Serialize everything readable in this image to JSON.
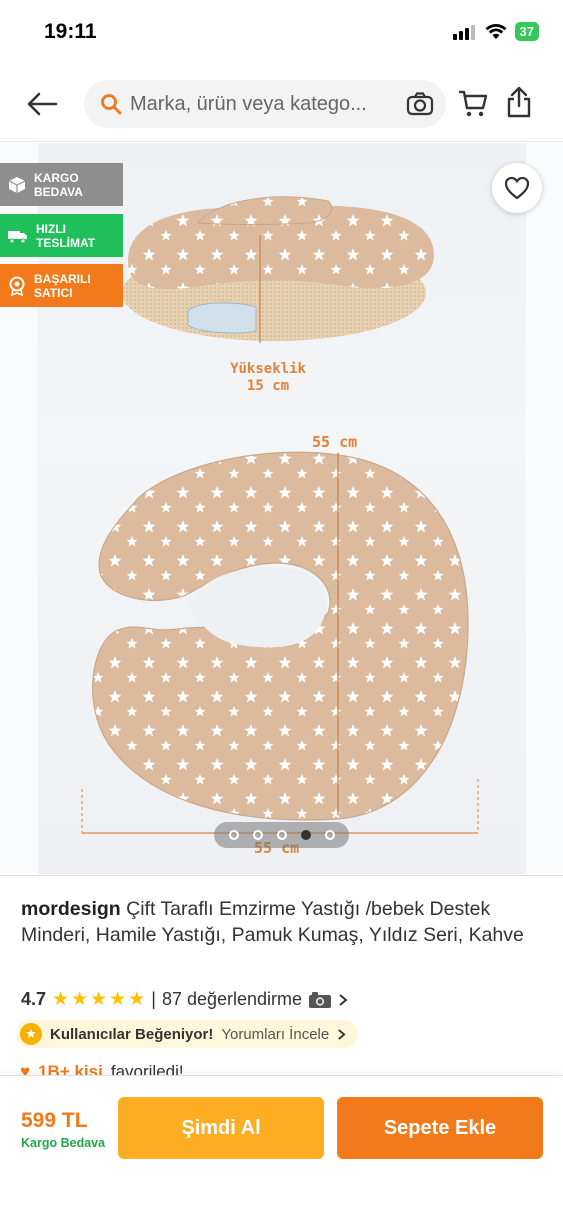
{
  "status_bar": {
    "time": "19:11",
    "battery": "37"
  },
  "header": {
    "search_placeholder": "Marka, ürün veya katego..."
  },
  "badges": [
    {
      "label": "KARGO BEDAVA",
      "line1": "KARGO",
      "line2": "BEDAVA"
    },
    {
      "label": "HIZLI TESLİMAT",
      "line1": "HIZLI",
      "line2": "TESLİMAT"
    },
    {
      "label": "BAŞARILI SATICI",
      "line1": "BAŞARILI",
      "line2": "SATICI"
    }
  ],
  "product_image": {
    "height_label_1": "Yükseklik",
    "height_label_2": "15 cm",
    "width_label_vertical": "55 cm",
    "width_label_horizontal": "55 cm",
    "total_images": 5,
    "active_index": 3
  },
  "product": {
    "brand": "mordesign",
    "name": "Çift Taraflı Emzirme Yastığı /bebek Destek Minderi, Hamile Yastığı, Pamuk Kumaş, Yıldız Seri, Kahve",
    "rating": "4.7",
    "stars": 5,
    "review_count": "87 değerlendirme",
    "separator": "|",
    "liked_label": "Kullanıcılar Beğeniyor!",
    "review_link": "Yorumları İncele",
    "fav_count": "1B+ kişi",
    "fav_text": "favoriledi!"
  },
  "bottom_bar": {
    "price": "599 TL",
    "shipping": "Kargo Bedava",
    "buy_now": "Şimdi Al",
    "add_to_cart": "Sepete Ekle"
  },
  "colors": {
    "accent_orange": "#f27a1a",
    "buy_yellow": "#fcad22",
    "green": "#1fbf5a",
    "pillow_beige": "#dbb89c"
  }
}
